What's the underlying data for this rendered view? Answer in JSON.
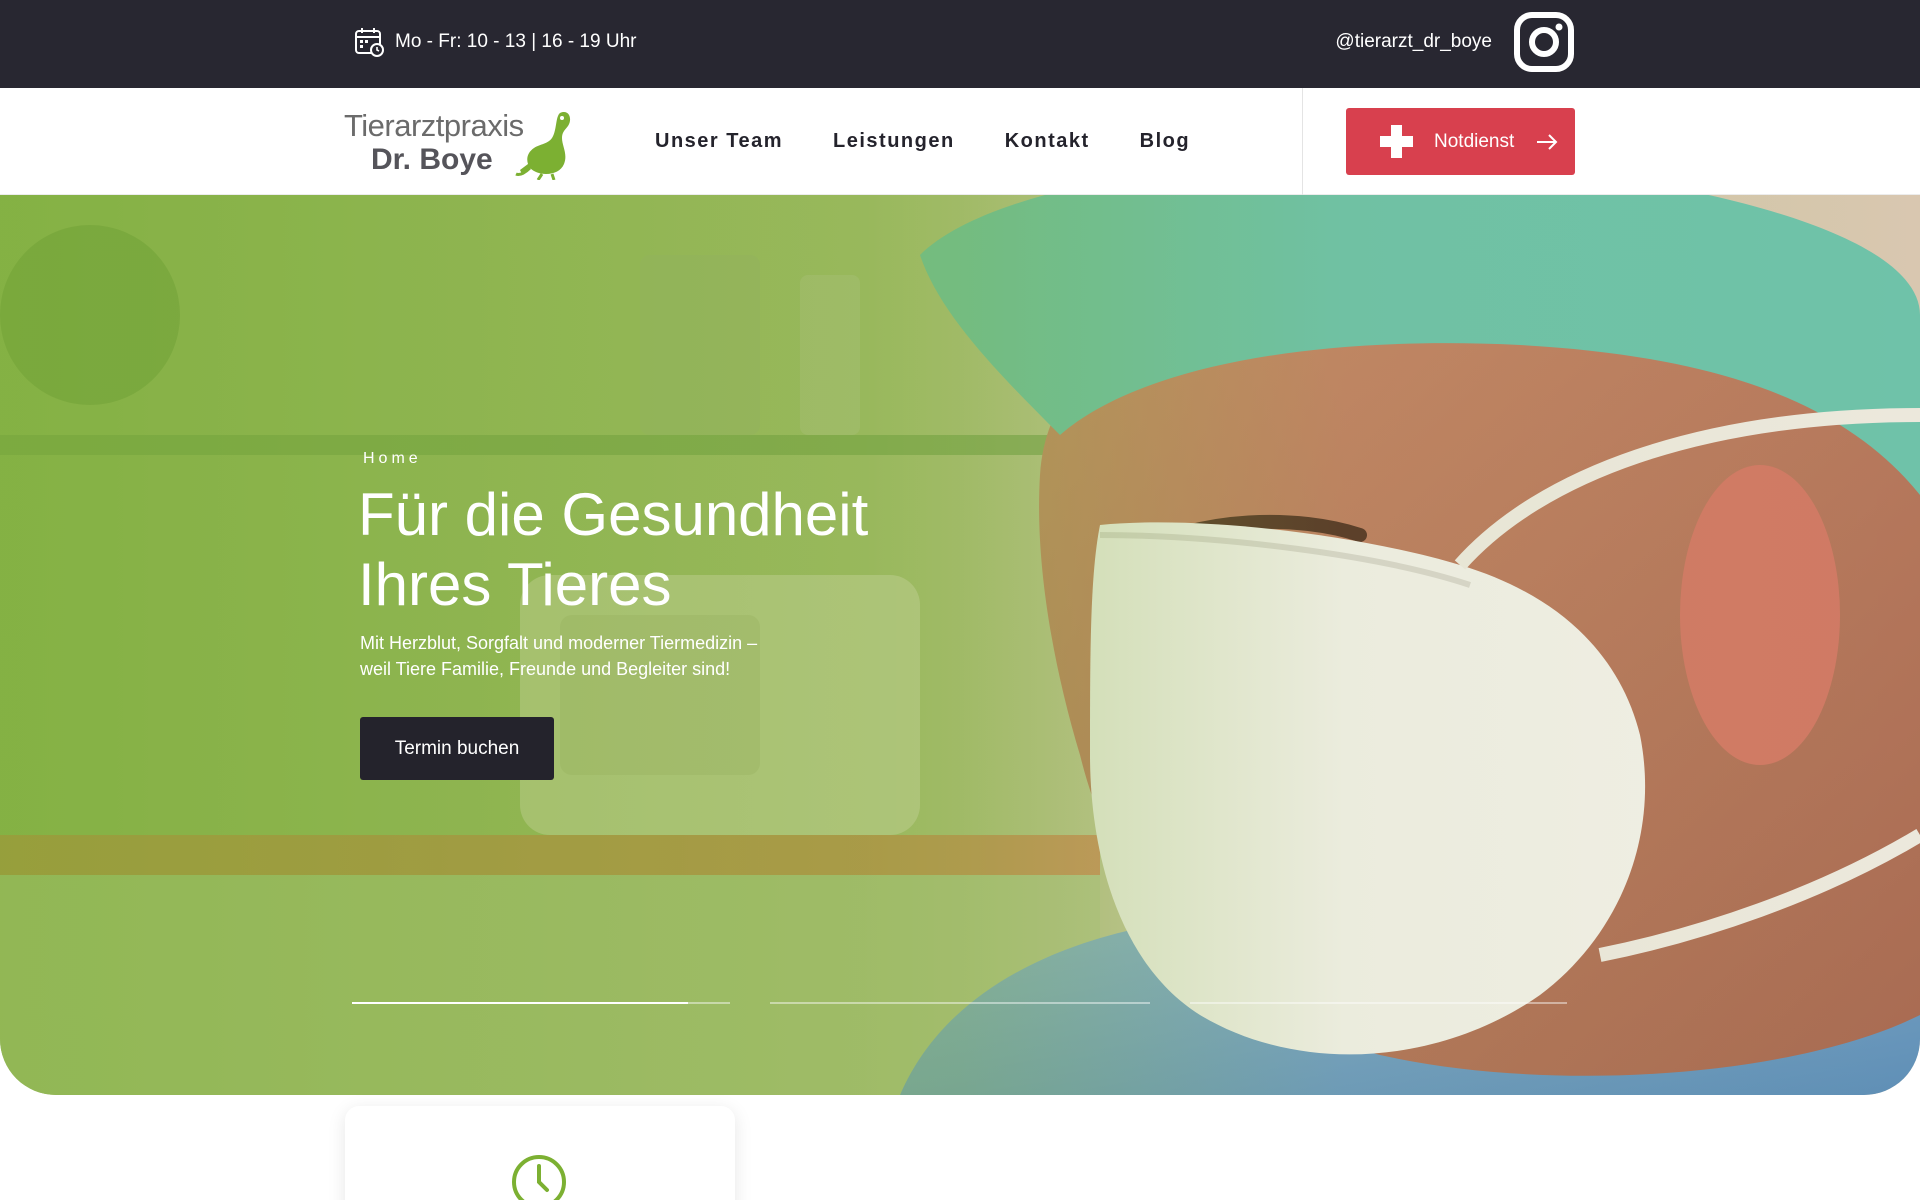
{
  "topbar": {
    "hours_text": "Mo - Fr:  10 - 13 | 16 - 19 Uhr",
    "hours_icon": "calendar-clock-icon",
    "instagram_handle": "@tierarzt_dr_boye",
    "instagram_icon": "instagram-icon"
  },
  "header": {
    "logo": {
      "line1": "Tierarztpraxis",
      "line2": "Dr. Boye",
      "icon": "green-cat-icon"
    },
    "nav": [
      "Unser Team",
      "Leistungen",
      "Kontakt",
      "Blog"
    ],
    "emergency_button": {
      "label": "Notdienst",
      "icon": "white-cross-icon",
      "arrow_icon": "arrow-right-icon"
    }
  },
  "hero": {
    "breadcrumb": "Home",
    "title_line1": "Für die Gesundheit",
    "title_line2": "Ihres Tieres",
    "subtitle_line1": "Mit Herzblut, Sorgfalt und moderner Tiermedizin –",
    "subtitle_line2": "weil Tiere Familie, Freunde und Begleiter sind!",
    "cta_label": "Termin buchen",
    "image_subject": "veterinarian-with-surgical-mask",
    "slider": {
      "slide_count": 3,
      "active_slide": 1,
      "active_progress": 0.89
    }
  },
  "info_card": {
    "icon": "clock-icon"
  },
  "colors": {
    "topbar_bg": "#282731",
    "accent_red": "#d8404e",
    "dark_button": "#24232c",
    "brand_green": "#7cb032",
    "text_dark": "#24232c"
  }
}
